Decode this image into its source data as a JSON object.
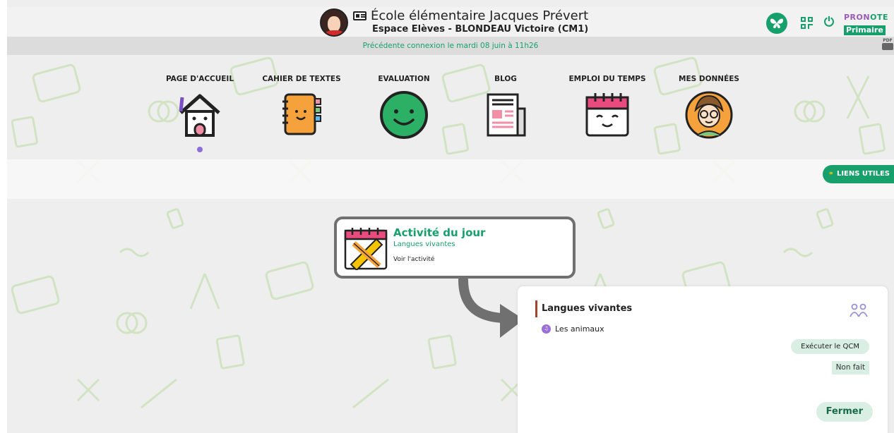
{
  "header": {
    "school_name": "École élémentaire Jacques Prévert",
    "space_name": "Espace Elèves - BLONDEAU Victoire (CM1)",
    "brand_top_a": "PRON",
    "brand_top_b": "OTE",
    "brand_bottom": "Primaire",
    "icons": {
      "avatar": "student-avatar",
      "id_card": "id-card-icon",
      "butterfly": "butterfly-icon",
      "qr": "qr-code-icon",
      "power": "power-icon",
      "pdf": "pdf-print-icon"
    },
    "pdf_label": "PDF"
  },
  "connection": {
    "text": "Précédente connexion le mardi 08 juin à 11h26"
  },
  "nav": {
    "items": [
      {
        "label": "PAGE D'ACCUEIL",
        "icon": "house-icon",
        "active": true
      },
      {
        "label": "CAHIER DE TEXTES",
        "icon": "notebook-icon",
        "active": false
      },
      {
        "label": "EVALUATION",
        "icon": "smiley-icon",
        "active": false
      },
      {
        "label": "BLOG",
        "icon": "newspaper-icon",
        "active": false
      },
      {
        "label": "EMPLOI DU TEMPS",
        "icon": "calendar-icon",
        "active": false
      },
      {
        "label": "MES DONNÉES",
        "icon": "boy-avatar-icon",
        "active": false
      }
    ]
  },
  "useful_links": {
    "label": "LIENS UTILES",
    "icon": "link-icon"
  },
  "activity": {
    "title": "Activité du jour",
    "subject": "Langues vivantes",
    "link": "Voir l'activité",
    "icon": "pencil-ruler-icon"
  },
  "detail": {
    "title": "Langues vivantes",
    "lesson": "Les animaux",
    "lesson_icon": "lesson-bubble-icon",
    "people_icon": "people-icon",
    "qcm_button": "Exécuter le QCM",
    "status": "Non fait",
    "close_button": "Fermer"
  },
  "colors": {
    "brand_green": "#17a06b",
    "brand_purple": "#9b5bb5",
    "accent_red": "#a4442f",
    "soft_green": "#d9efe3"
  }
}
